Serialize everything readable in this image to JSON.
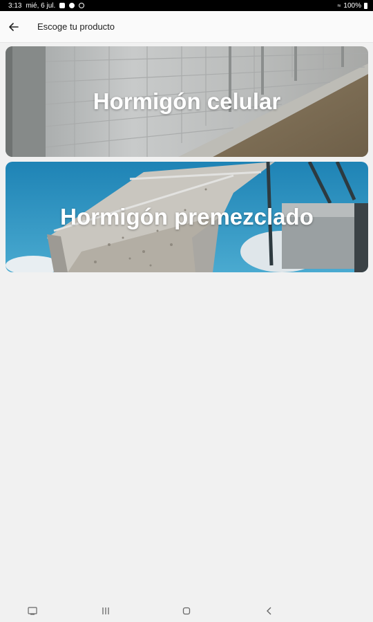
{
  "status_bar": {
    "time": "3:13",
    "date": "mié, 6 jul.",
    "battery": "100%"
  },
  "app_bar": {
    "title": "Escoge tu producto",
    "back_icon": "arrow-left-icon"
  },
  "products": [
    {
      "label": "Hormigón celular"
    },
    {
      "label": "Hormigón premezclado"
    }
  ],
  "nav_bar": {
    "icons": [
      "screenshot-icon",
      "recents-icon",
      "home-icon",
      "back-icon"
    ]
  },
  "colors": {
    "background": "#f1f1f1",
    "app_bar": "#fafafa",
    "status_bar": "#000000"
  }
}
